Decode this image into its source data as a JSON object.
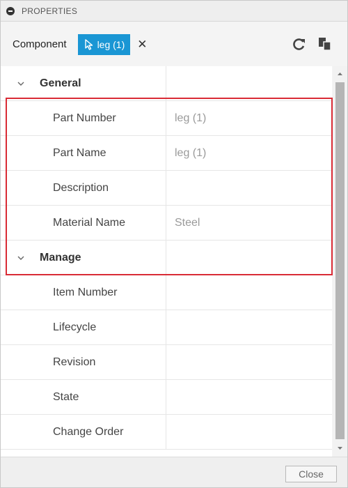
{
  "titlebar": {
    "title": "PROPERTIES"
  },
  "component": {
    "label": "Component",
    "chip_label": "leg (1)"
  },
  "groups": [
    {
      "label": "General",
      "rows": [
        {
          "name": "Part Number",
          "value": "leg (1)"
        },
        {
          "name": "Part Name",
          "value": "leg (1)"
        },
        {
          "name": "Description",
          "value": ""
        },
        {
          "name": "Material Name",
          "value": "Steel"
        }
      ]
    },
    {
      "label": "Manage",
      "rows": [
        {
          "name": "Item Number",
          "value": ""
        },
        {
          "name": "Lifecycle",
          "value": ""
        },
        {
          "name": "Revision",
          "value": ""
        },
        {
          "name": "State",
          "value": ""
        },
        {
          "name": "Change Order",
          "value": ""
        }
      ]
    }
  ],
  "footer": {
    "close_label": "Close"
  },
  "colors": {
    "chip": "#1a96d4",
    "highlight": "#d92b35"
  },
  "icons": [
    "collapse-icon",
    "cursor-icon",
    "close-x-icon",
    "reload-icon",
    "copy-icon",
    "chevron-down-icon",
    "scroll-up-icon",
    "scroll-down-icon"
  ]
}
